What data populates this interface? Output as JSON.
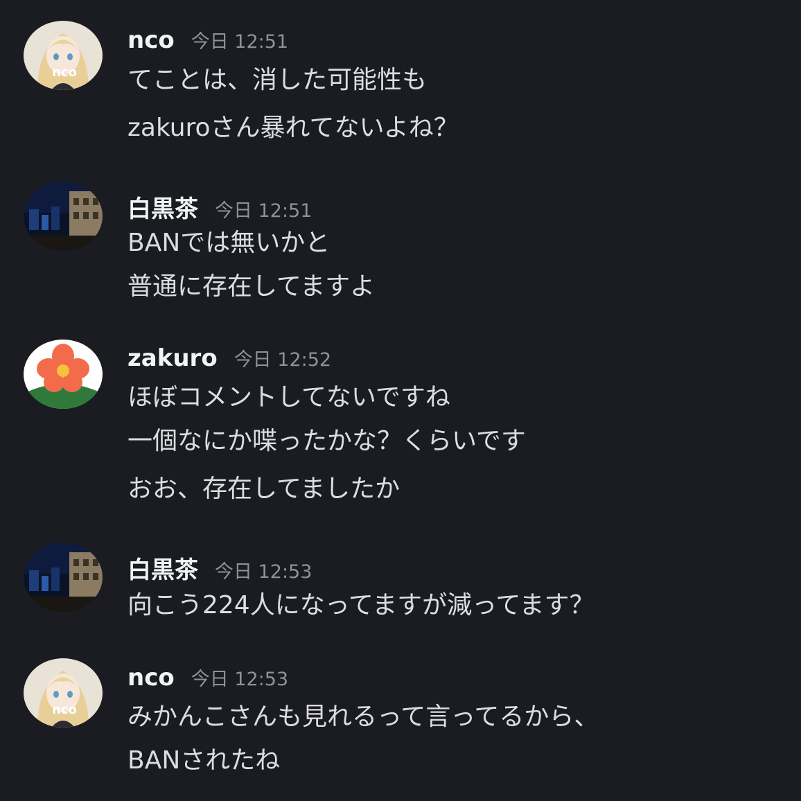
{
  "messages": [
    {
      "author": "nco",
      "time": "今日 12:51",
      "avatar": "anime-girl-avatar",
      "lines": [
        "てことは、消した可能性も",
        "zakuroさん暴れてないよね？"
      ]
    },
    {
      "author": "白黒茶",
      "time": "今日 12:51",
      "avatar": "night-city-avatar",
      "lines": [
        "BANでは無いかと",
        "普通に存在してますよ"
      ]
    },
    {
      "author": "zakuro",
      "time": "今日 12:52",
      "avatar": "flower-avatar",
      "lines": [
        "ほぼコメントしてないですね",
        "一個なにか喋ったかな？くらいです",
        "おお、存在してましたか"
      ]
    },
    {
      "author": "白黒茶",
      "time": "今日 12:53",
      "avatar": "night-city-avatar",
      "lines": [
        "向こう224人になってますが減ってます？"
      ]
    },
    {
      "author": "nco",
      "time": "今日 12:53",
      "avatar": "anime-girl-avatar",
      "lines": [
        "みかんこさんも見れるって言ってるから、",
        "BANされたね"
      ]
    }
  ],
  "avatar_text": {
    "nco": "nco"
  },
  "colors": {
    "background": "#1b1c21",
    "author": "#f2f3f5",
    "timestamp": "#8f929a",
    "message_text": "#dcdde1"
  }
}
